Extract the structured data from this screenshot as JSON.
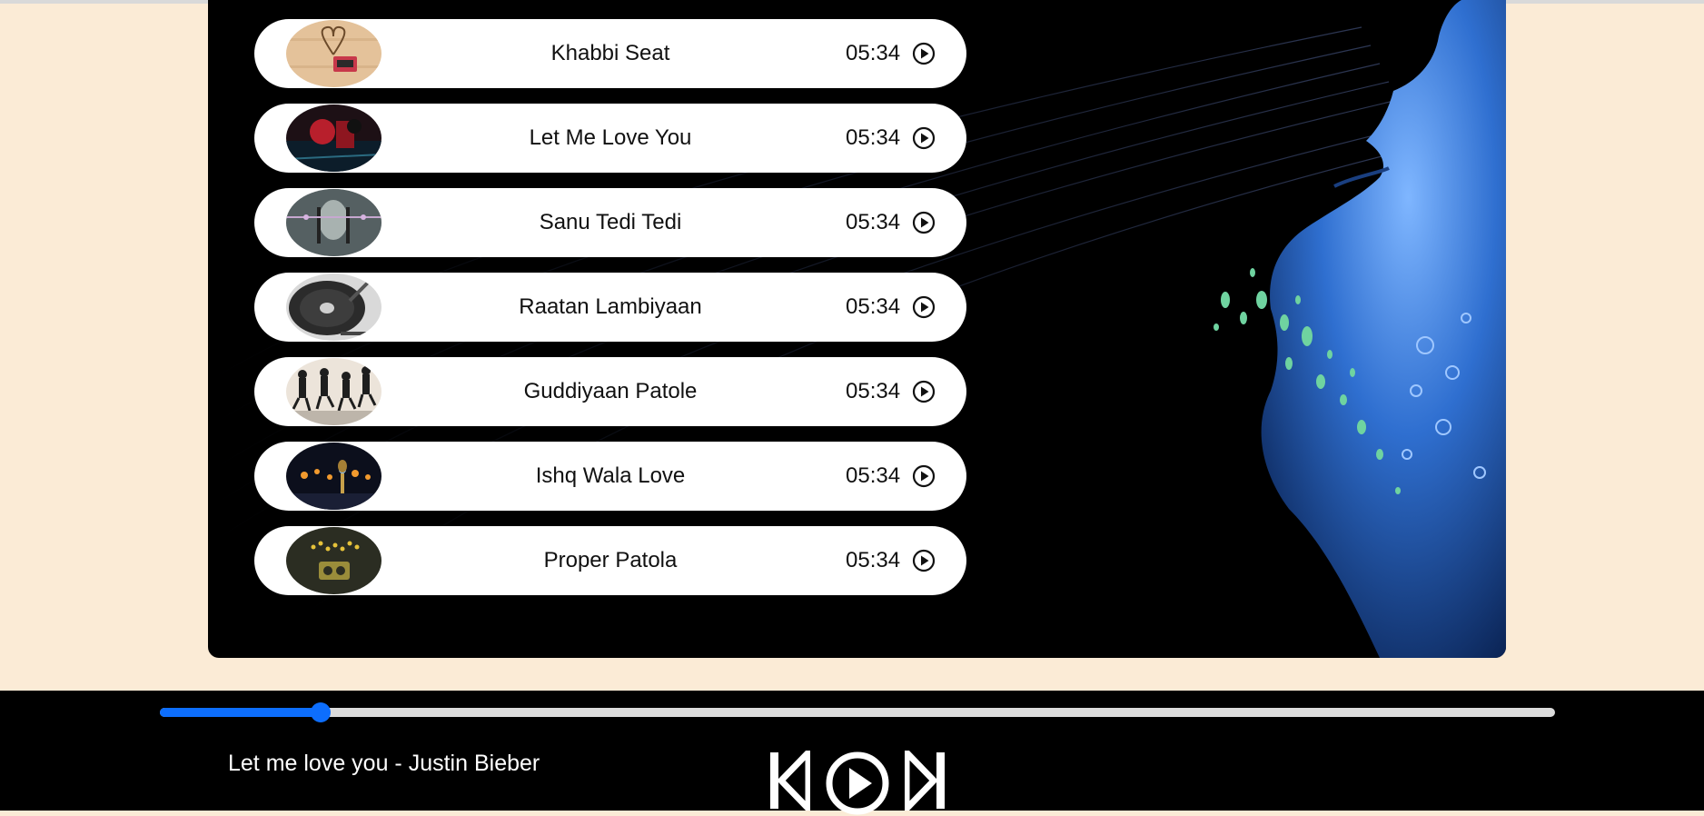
{
  "songs": [
    {
      "title": "Khabbi Seat",
      "duration": "05:34",
      "thumb": "cassette-heart"
    },
    {
      "title": "Let Me Love You",
      "duration": "05:34",
      "thumb": "red-stage"
    },
    {
      "title": "Sanu Tedi Tedi",
      "duration": "05:34",
      "thumb": "anime-girl"
    },
    {
      "title": "Raatan Lambiyaan",
      "duration": "05:34",
      "thumb": "vinyl-turntable"
    },
    {
      "title": "Guddiyaan Patole",
      "duration": "05:34",
      "thumb": "jumping-band"
    },
    {
      "title": "Ishq Wala Love",
      "duration": "05:34",
      "thumb": "concert-mic"
    },
    {
      "title": "Proper Patola",
      "duration": "05:34",
      "thumb": "radio-lights"
    }
  ],
  "player": {
    "now_playing": "Let me love you - Justin Bieber",
    "progress": 0.115,
    "controls": [
      "previous-icon",
      "play-icon",
      "next-icon"
    ]
  },
  "colors": {
    "page_bg": "#fbebd6",
    "accent": "#0d6efd",
    "stage_bg": "#000000"
  }
}
